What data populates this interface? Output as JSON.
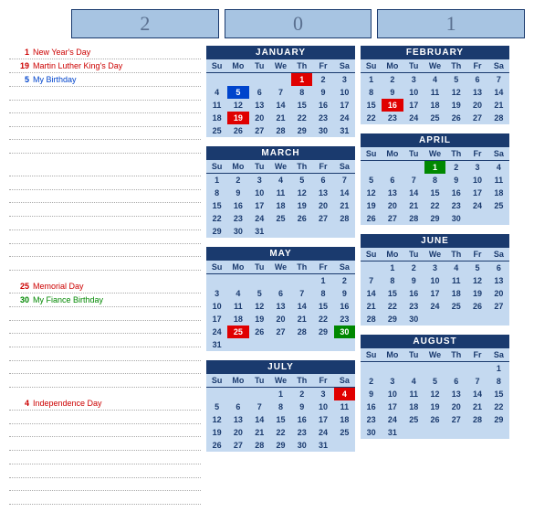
{
  "year_boxes": [
    "2",
    "0",
    "1"
  ],
  "dow": [
    "Su",
    "Mo",
    "Tu",
    "We",
    "Th",
    "Fr",
    "Sa"
  ],
  "event_blocks": [
    {
      "events": [
        {
          "day": "1",
          "label": "New Year's Day",
          "color": "red"
        },
        {
          "day": "19",
          "label": "Martin Luther King's Day",
          "color": "red"
        },
        {
          "day": "5",
          "label": "My Birthday",
          "color": "blue"
        }
      ],
      "blanks": 5
    },
    {
      "events": [],
      "blanks": 8
    },
    {
      "events": [
        {
          "day": "25",
          "label": "Memorial Day",
          "color": "red"
        },
        {
          "day": "30",
          "label": "My Fiance Birthday",
          "color": "green"
        }
      ],
      "blanks": 6
    },
    {
      "events": [
        {
          "day": "4",
          "label": "Independence Day",
          "color": "red"
        }
      ],
      "blanks": 7
    }
  ],
  "months_col1": [
    {
      "name": "JANUARY",
      "weeks": [
        [
          "",
          "",
          "",
          "",
          "1",
          "2",
          "3"
        ],
        [
          "4",
          "5",
          "6",
          "7",
          "8",
          "9",
          "10"
        ],
        [
          "11",
          "12",
          "13",
          "14",
          "15",
          "16",
          "17"
        ],
        [
          "18",
          "19",
          "20",
          "21",
          "22",
          "23",
          "24"
        ],
        [
          "25",
          "26",
          "27",
          "28",
          "29",
          "30",
          "31"
        ]
      ],
      "highlights": {
        "1": "red",
        "5": "blue",
        "19": "red"
      }
    },
    {
      "name": "MARCH",
      "weeks": [
        [
          "1",
          "2",
          "3",
          "4",
          "5",
          "6",
          "7"
        ],
        [
          "8",
          "9",
          "10",
          "11",
          "12",
          "13",
          "14"
        ],
        [
          "15",
          "16",
          "17",
          "18",
          "19",
          "20",
          "21"
        ],
        [
          "22",
          "23",
          "24",
          "25",
          "26",
          "27",
          "28"
        ],
        [
          "29",
          "30",
          "31",
          "",
          "",
          "",
          ""
        ]
      ],
      "highlights": {}
    },
    {
      "name": "MAY",
      "weeks": [
        [
          "",
          "",
          "",
          "",
          "",
          "1",
          "2"
        ],
        [
          "3",
          "4",
          "5",
          "6",
          "7",
          "8",
          "9"
        ],
        [
          "10",
          "11",
          "12",
          "13",
          "14",
          "15",
          "16"
        ],
        [
          "17",
          "18",
          "19",
          "20",
          "21",
          "22",
          "23"
        ],
        [
          "24",
          "25",
          "26",
          "27",
          "28",
          "29",
          "30"
        ],
        [
          "31",
          "",
          "",
          "",
          "",
          "",
          ""
        ]
      ],
      "highlights": {
        "25": "red",
        "30": "green"
      }
    },
    {
      "name": "JULY",
      "weeks": [
        [
          "",
          "",
          "",
          "1",
          "2",
          "3",
          "4"
        ],
        [
          "5",
          "6",
          "7",
          "8",
          "9",
          "10",
          "11"
        ],
        [
          "12",
          "13",
          "14",
          "15",
          "16",
          "17",
          "18"
        ],
        [
          "19",
          "20",
          "21",
          "22",
          "23",
          "24",
          "25"
        ],
        [
          "26",
          "27",
          "28",
          "29",
          "30",
          "31",
          ""
        ]
      ],
      "highlights": {
        "4": "red"
      }
    }
  ],
  "months_col2": [
    {
      "name": "FEBRUARY",
      "weeks": [
        [
          "1",
          "2",
          "3",
          "4",
          "5",
          "6",
          "7"
        ],
        [
          "8",
          "9",
          "10",
          "11",
          "12",
          "13",
          "14"
        ],
        [
          "15",
          "16",
          "17",
          "18",
          "19",
          "20",
          "21"
        ],
        [
          "22",
          "23",
          "24",
          "25",
          "26",
          "27",
          "28"
        ]
      ],
      "highlights": {
        "16": "red"
      }
    },
    {
      "name": "APRIL",
      "weeks": [
        [
          "",
          "",
          "",
          "1",
          "2",
          "3",
          "4"
        ],
        [
          "5",
          "6",
          "7",
          "8",
          "9",
          "10",
          "11"
        ],
        [
          "12",
          "13",
          "14",
          "15",
          "16",
          "17",
          "18"
        ],
        [
          "19",
          "20",
          "21",
          "22",
          "23",
          "24",
          "25"
        ],
        [
          "26",
          "27",
          "28",
          "29",
          "30",
          "",
          ""
        ]
      ],
      "highlights": {
        "1": "green"
      }
    },
    {
      "name": "JUNE",
      "weeks": [
        [
          "",
          "1",
          "2",
          "3",
          "4",
          "5",
          "6"
        ],
        [
          "7",
          "8",
          "9",
          "10",
          "11",
          "12",
          "13"
        ],
        [
          "14",
          "15",
          "16",
          "17",
          "18",
          "19",
          "20"
        ],
        [
          "21",
          "22",
          "23",
          "24",
          "25",
          "26",
          "27"
        ],
        [
          "28",
          "29",
          "30",
          "",
          "",
          "",
          ""
        ]
      ],
      "highlights": {}
    },
    {
      "name": "AUGUST",
      "weeks": [
        [
          "",
          "",
          "",
          "",
          "",
          "",
          "1"
        ],
        [
          "2",
          "3",
          "4",
          "5",
          "6",
          "7",
          "8"
        ],
        [
          "9",
          "10",
          "11",
          "12",
          "13",
          "14",
          "15"
        ],
        [
          "16",
          "17",
          "18",
          "19",
          "20",
          "21",
          "22"
        ],
        [
          "23",
          "24",
          "25",
          "26",
          "27",
          "28",
          "29"
        ],
        [
          "30",
          "31",
          "",
          "",
          "",
          "",
          ""
        ]
      ],
      "highlights": {}
    }
  ]
}
